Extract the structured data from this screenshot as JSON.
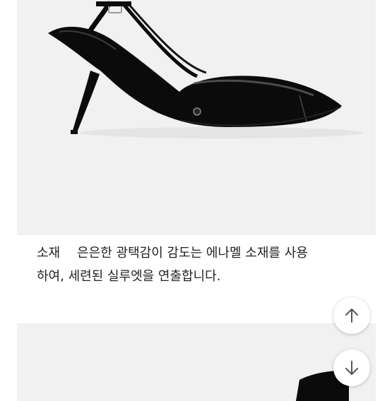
{
  "product_image": {
    "icon": "black-patent-slingback-heel-photo",
    "background": "#f1f1f1",
    "shoe_color": "#0b0b0b"
  },
  "description": {
    "label": "소재",
    "line1": "은은한 광택감이 감도는 에나멜 소재를 사용",
    "line2": "하여, 세련된 실루엣을 연출합니다."
  },
  "controls": {
    "scroll_up_icon": "arrow-up-icon",
    "scroll_down_icon": "arrow-down-icon"
  }
}
